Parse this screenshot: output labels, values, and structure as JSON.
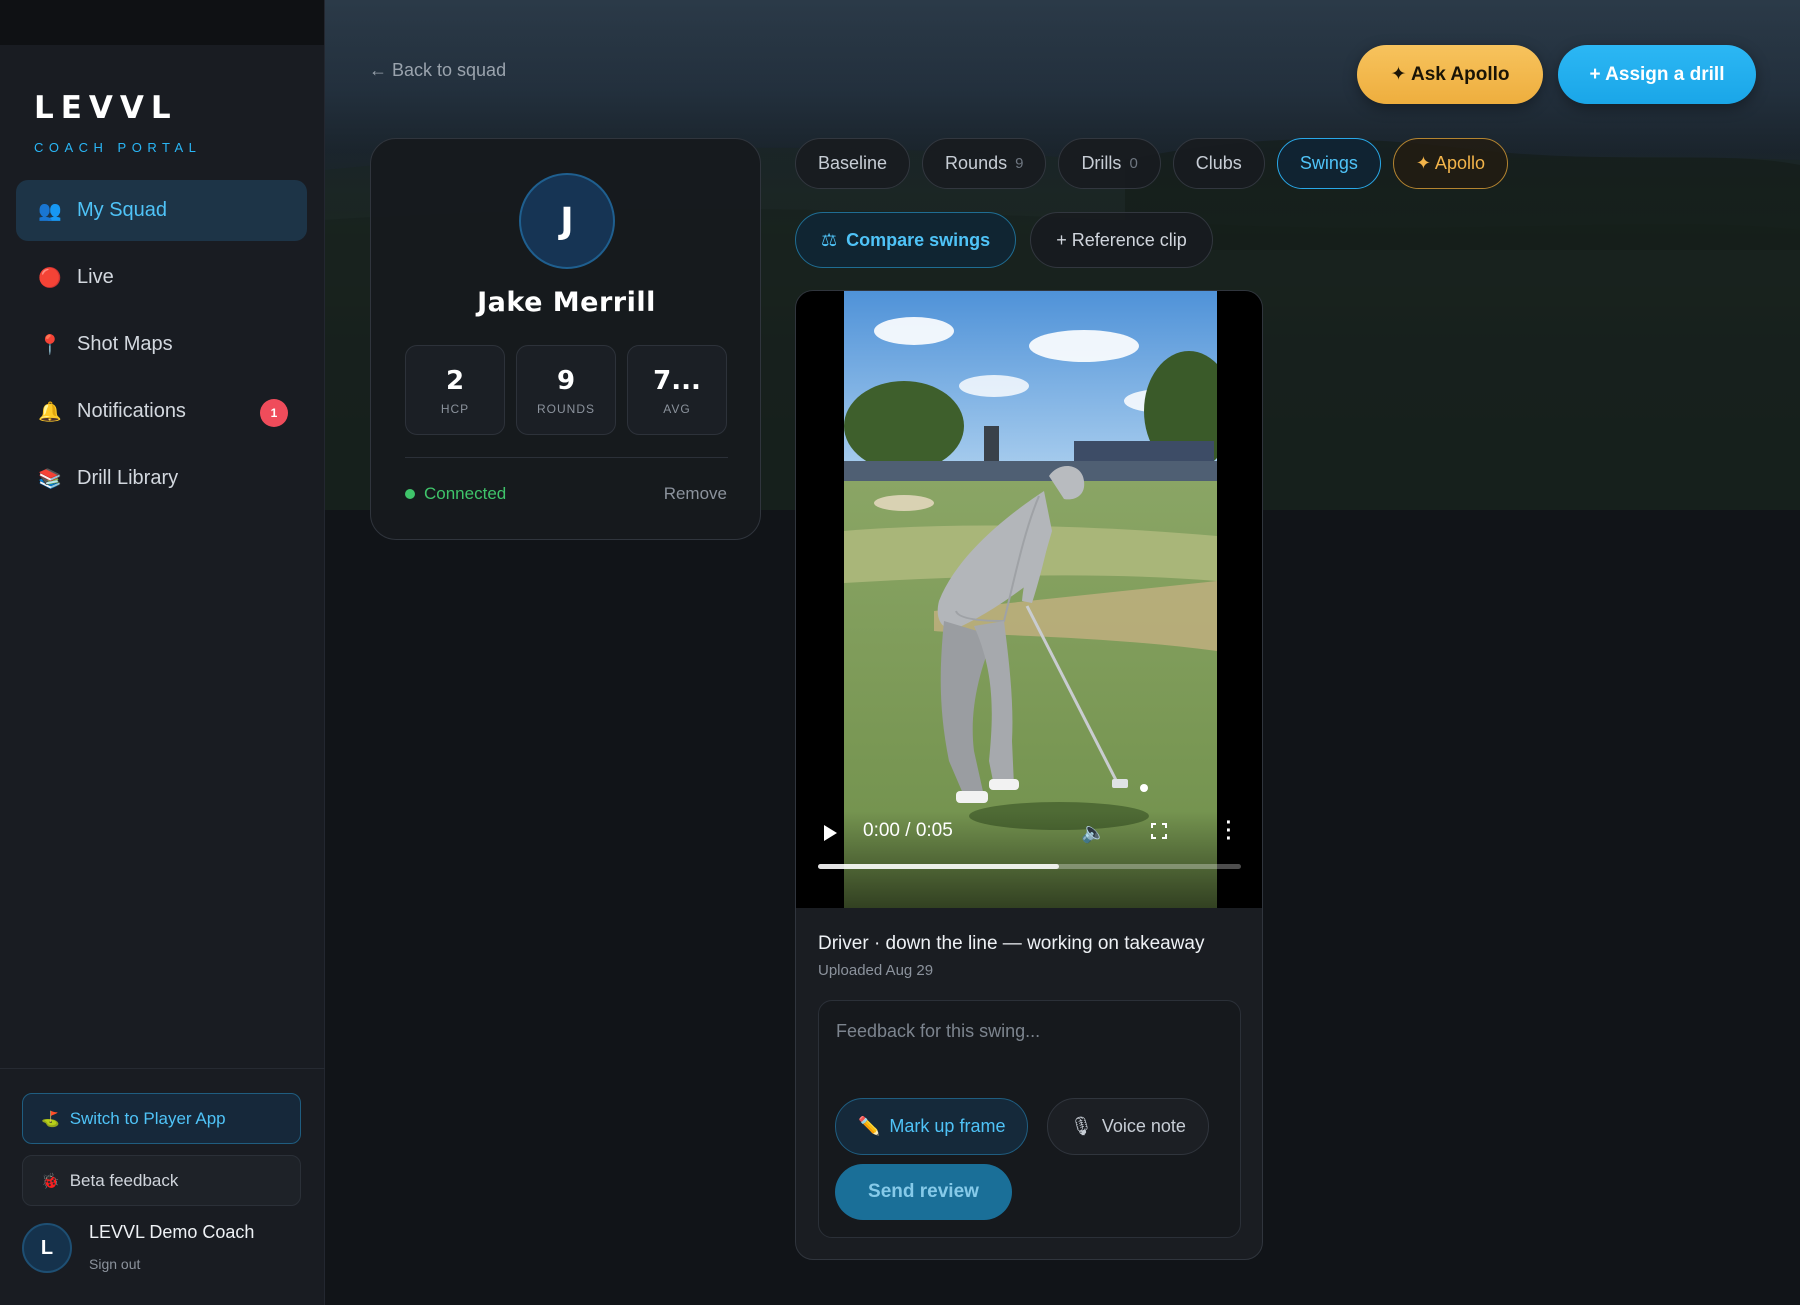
{
  "brand": {
    "name": "LEVVL",
    "subtitle": "COACH PORTAL"
  },
  "sidebar": {
    "items": [
      {
        "label": "My Squad",
        "icon": "people-icon",
        "glyph": "👥"
      },
      {
        "label": "Live",
        "icon": "red-circle-icon",
        "glyph": "🔴"
      },
      {
        "label": "Shot Maps",
        "icon": "pin-icon",
        "glyph": "📍"
      },
      {
        "label": "Notifications",
        "icon": "bell-icon",
        "glyph": "🔔",
        "badge": "1"
      },
      {
        "label": "Drill Library",
        "icon": "books-icon",
        "glyph": "📚"
      }
    ],
    "switch_label": "Switch to Player App",
    "beta_label": "Beta feedback",
    "coach": {
      "initial": "L",
      "name": "LEVVL Demo Coach",
      "signout": "Sign out"
    }
  },
  "header": {
    "back_label": "← Back to squad",
    "ask_label": "✦ Ask Apollo",
    "assign_label": "+ Assign a drill"
  },
  "player": {
    "initial": "J",
    "name": "Jake Merrill",
    "stats": [
      {
        "value": "2",
        "label": "HCP"
      },
      {
        "value": "9",
        "label": "ROUNDS"
      },
      {
        "value": "7...",
        "label": "AVG"
      }
    ],
    "status": "Connected",
    "remove_label": "Remove"
  },
  "tabs": [
    {
      "label": "Baseline",
      "count": ""
    },
    {
      "label": "Rounds",
      "count": "9"
    },
    {
      "label": "Drills",
      "count": "0"
    },
    {
      "label": "Clubs",
      "count": ""
    },
    {
      "label": "Swings",
      "count": ""
    },
    {
      "label": "✦ Apollo",
      "count": ""
    }
  ],
  "active_tab": "Swings",
  "actions": {
    "compare_label": "Compare swings",
    "reference_label": "+ Reference clip"
  },
  "swing": {
    "video_time": "0:00 / 0:05",
    "progress": 0.57,
    "title": "Driver · down the line — working on takeaway",
    "uploaded": "Uploaded Aug 29",
    "feedback_placeholder": "Feedback for this swing...",
    "markup_label": "Mark up frame",
    "voice_label": "Voice note",
    "send_label": "Send review"
  },
  "colors": {
    "accent": "#29b6f6",
    "apollo": "#f3b44a",
    "connected": "#3fc46a",
    "badge": "#ef4c5b"
  }
}
